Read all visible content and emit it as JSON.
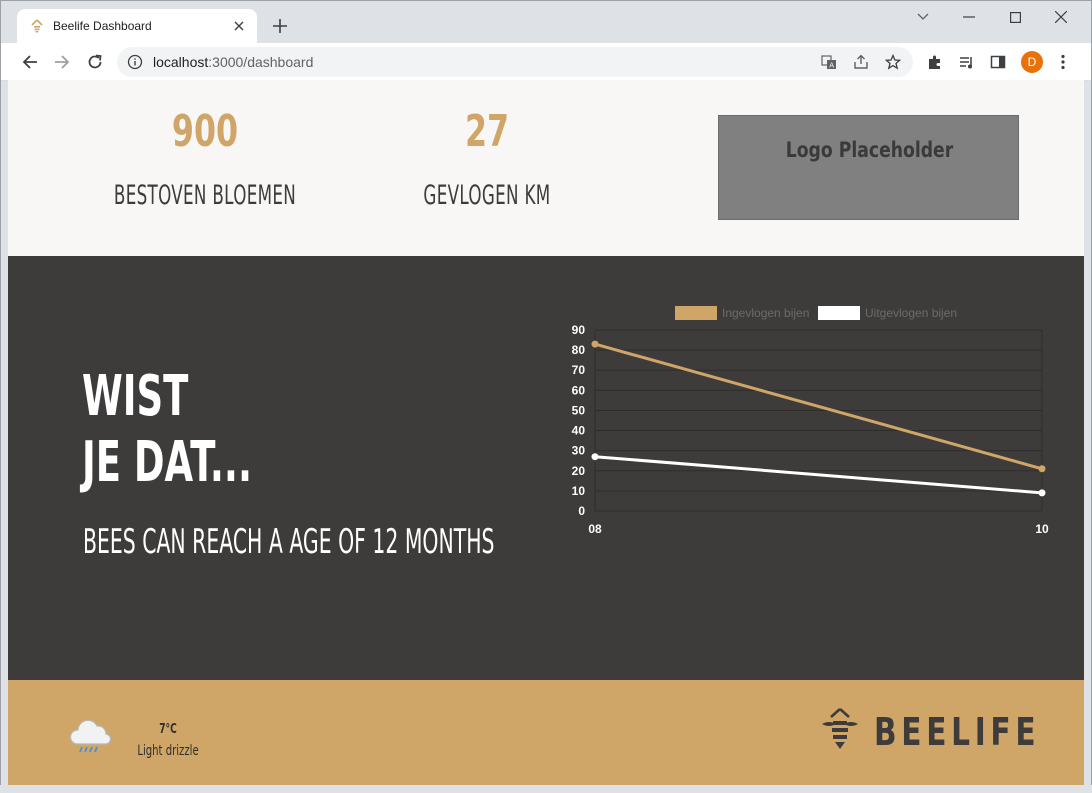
{
  "browser": {
    "tab_title": "Beelife Dashboard",
    "url_host": "localhost",
    "url_rest": ":3000/dashboard",
    "profile_initial": "D",
    "icons": [
      "back-icon",
      "forward-icon",
      "reload-icon",
      "site-info-icon",
      "translate-icon",
      "share-icon",
      "bookmark-star-icon",
      "extensions-icon",
      "media-icon",
      "side-panel-icon",
      "menu-icon"
    ]
  },
  "stats": {
    "flowers_value": "900",
    "flowers_label": "BESTOVEN BLOEMEN",
    "km_value": "27",
    "km_label": "GEVLOGEN KM",
    "logo_label": "Logo Placeholder"
  },
  "fact": {
    "title_line1": "WIST",
    "title_line2": "JE DAT...",
    "text": "BEES CAN REACH A AGE OF 12 MONTHS"
  },
  "chart_data": {
    "type": "line",
    "x": [
      "08",
      "10"
    ],
    "series": [
      {
        "name": "Ingevlogen bijen",
        "values": [
          83,
          21
        ],
        "color": "#cfa667"
      },
      {
        "name": "Uitgevlogen bijen",
        "values": [
          27,
          9
        ],
        "color": "#ffffff"
      }
    ],
    "ylim": [
      0,
      90
    ],
    "yticks": [
      "0",
      "10",
      "20",
      "30",
      "40",
      "50",
      "60",
      "70",
      "80",
      "90"
    ],
    "grid": true,
    "legend": "top"
  },
  "footer": {
    "temperature": "7°C",
    "weather": "Light drizzle",
    "brand": "BEELIFE"
  },
  "colors": {
    "gold": "#cfa667",
    "dark": "#3e3c3b",
    "light": "#f8f7f5"
  }
}
